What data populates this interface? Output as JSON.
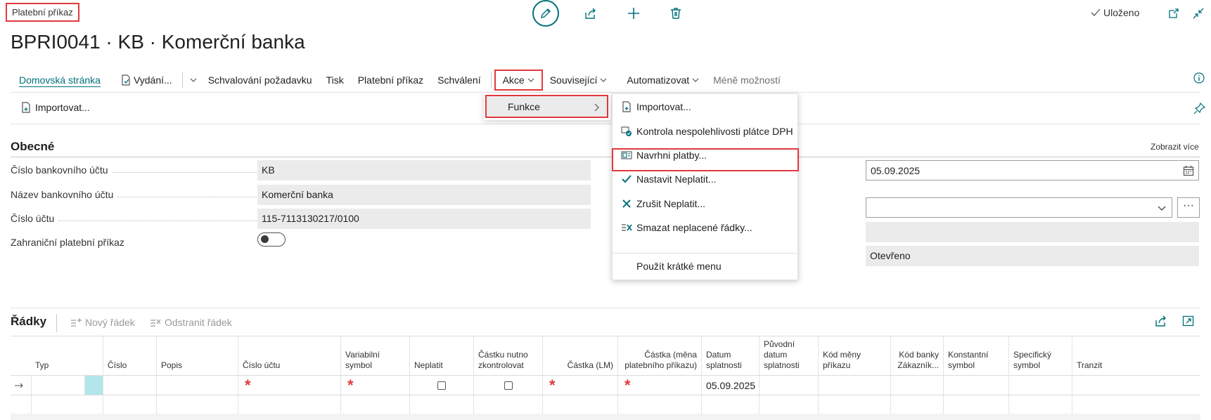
{
  "header": {
    "breadcrumb": "Platební příkaz",
    "saved_label": "Uloženo",
    "title": "BPRI0041 · KB · Komerční banka"
  },
  "actions": {
    "home": "Domovská stránka",
    "issue": "Vydání...",
    "approval_request": "Schvalování požadavku",
    "print": "Tisk",
    "payment_order": "Platební příkaz",
    "approval": "Schválení",
    "akce": "Akce",
    "related": "Související",
    "automate": "Automatizovat",
    "fewer": "Méně možností"
  },
  "subbar": {
    "import": "Importovat..."
  },
  "submenu": {
    "funkce": "Funkce"
  },
  "dropdown": {
    "items": [
      "Importovat...",
      "Kontrola nespolehlivosti plátce DPH",
      "Navrhni platby...",
      "Nastavit Neplatit...",
      "Zrušit Neplatit...",
      "Smazat neplacené řádky...",
      "Použít krátké menu"
    ]
  },
  "general": {
    "title": "Obecné",
    "show_more": "Zobrazit více",
    "fields": [
      {
        "label": "Číslo bankovního účtu",
        "value": "KB"
      },
      {
        "label": "Název bankovního účtu",
        "value": "Komerční banka"
      },
      {
        "label": "Číslo účtu",
        "value": "115-7113130217/0100"
      },
      {
        "label": "Zahraniční platební příkaz",
        "value": ""
      }
    ],
    "right": {
      "date": "05.09.2025",
      "select": "",
      "readonly": "",
      "status": "Otevřeno"
    }
  },
  "lines": {
    "title": "Řádky",
    "new_line": "Nový řádek",
    "delete_line": "Odstranit řádek",
    "columns": [
      "Typ",
      "Číslo",
      "Popis",
      "Číslo účtu",
      "Variabilní symbol",
      "Neplatit",
      "Částku nutno zkontrolovat",
      "Částka (LM)",
      "Částka (měna platebního příkazu)",
      "Datum splatnosti",
      "Původní datum splatnosti",
      "Kód měny příkazu",
      "Kód banky Zákazník...",
      "Konstantní symbol",
      "Specifický symbol",
      "Tranzit"
    ],
    "row1": {
      "due_date": "05.09.2025"
    }
  }
}
